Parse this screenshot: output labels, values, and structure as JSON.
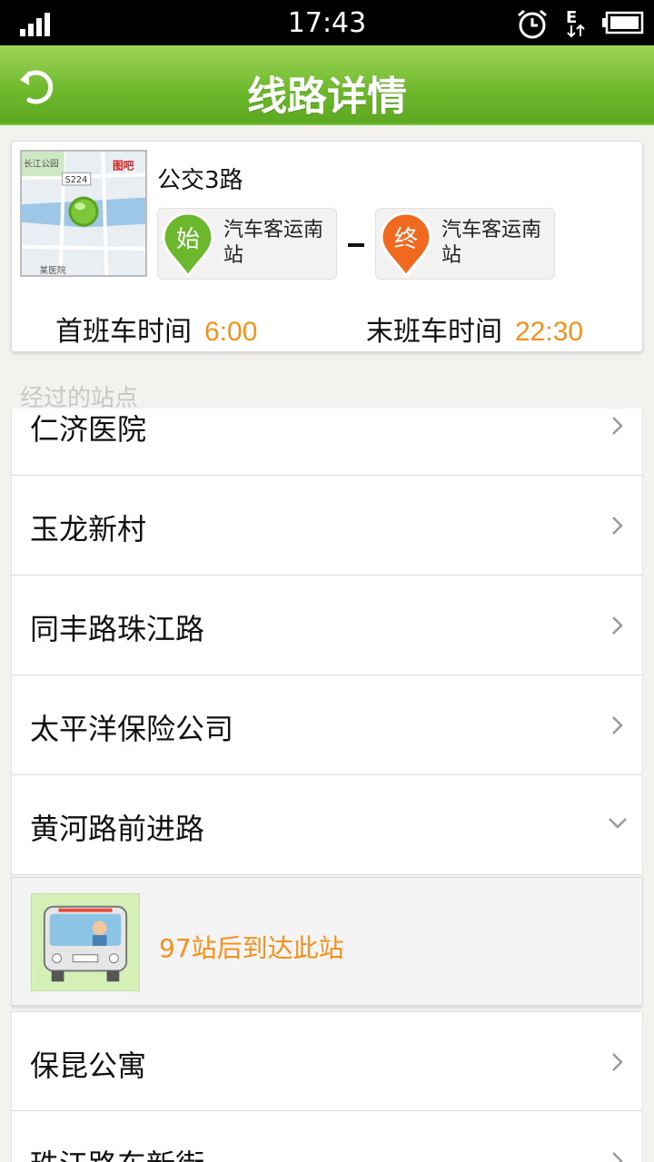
{
  "status_bar": {
    "time": "17:43"
  },
  "header": {
    "title": "线路详情"
  },
  "route": {
    "name": "公交3路",
    "start": {
      "badge": "始",
      "station": "汽车客运南站"
    },
    "end": {
      "badge": "终",
      "station": "汽车客运南站"
    },
    "first_bus_label": "首班车时间",
    "first_bus_time": "6:00",
    "last_bus_label": "末班车时间",
    "last_bus_time": "22:30",
    "map": {
      "park_label": "长江公园",
      "road_label": "S224",
      "brand": "图吧",
      "bottom_label": "某医院"
    }
  },
  "section_title": "经过的站点",
  "stations_before": [
    "仁济医院",
    "玉龙新村",
    "同丰路珠江路",
    "太平洋保险公司",
    "黄河路前进路"
  ],
  "arrival_notice": "97站后到达此站",
  "stations_after": [
    "保昆公寓",
    "珠江路东新街"
  ]
}
